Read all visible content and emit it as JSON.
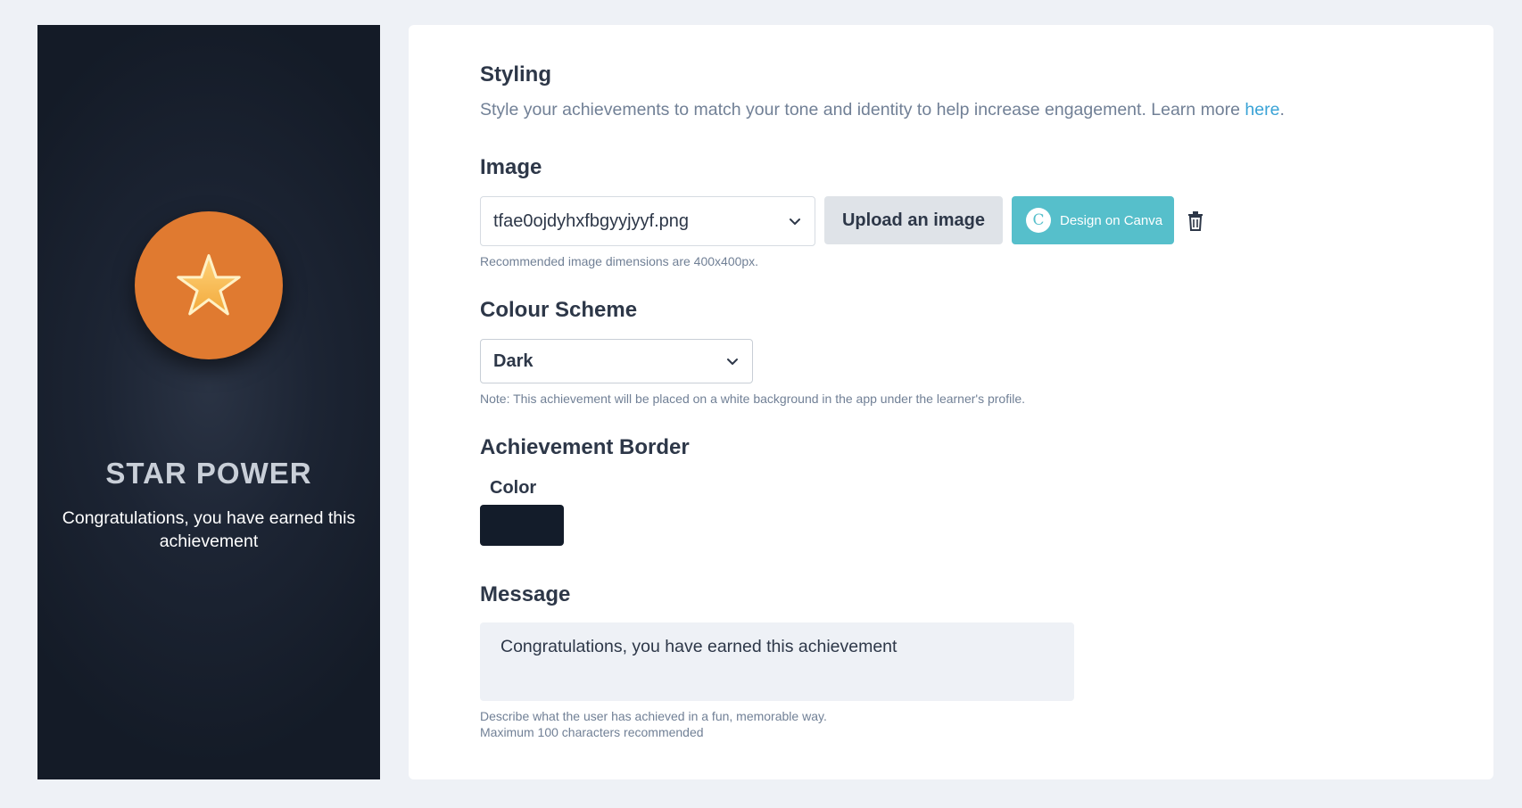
{
  "preview": {
    "title": "STAR POWER",
    "message": "Congratulations, you have earned this achievement",
    "badge_color": "#e07a30",
    "icon": "star-icon"
  },
  "styling": {
    "title": "Styling",
    "description": "Style your achievements to match your tone and identity to help increase engagement. Learn more",
    "link_text": "here",
    "link_suffix": "."
  },
  "image": {
    "title": "Image",
    "selected_file": "tfae0ojdyhxfbgyyjyyf.png",
    "upload_label": "Upload an image",
    "canva_label": "Design on Canva",
    "canva_icon_letter": "C",
    "hint": "Recommended image dimensions are 400x400px."
  },
  "colour_scheme": {
    "title": "Colour Scheme",
    "selected": "Dark",
    "note": "Note: This achievement will be placed on a white background in the app under the learner's profile."
  },
  "border": {
    "title": "Achievement Border",
    "color_label": "Color",
    "color_value": "#131c2a"
  },
  "message": {
    "title": "Message",
    "value": "Congratulations, you have earned this achievement",
    "hint_line1": "Describe what the user has achieved in a fun, memorable way.",
    "hint_line2": "Maximum 100 characters recommended"
  }
}
